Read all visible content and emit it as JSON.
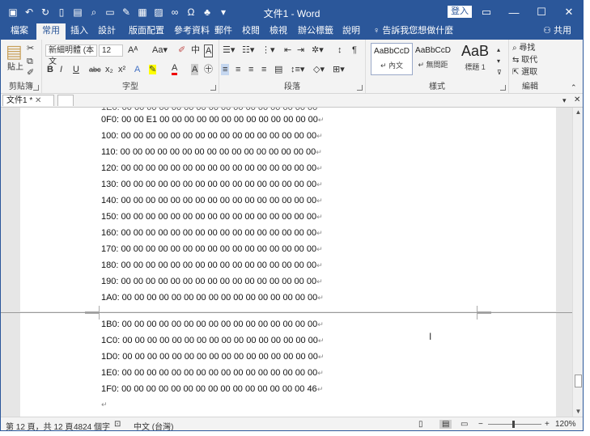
{
  "window": {
    "title": "文件1 - Word",
    "signin_label": "登入",
    "controls": [
      "▭",
      "—",
      "☐",
      "✕"
    ]
  },
  "qat": {
    "icons": [
      "save-icon",
      "undo-icon",
      "redo-icon",
      "new-icon",
      "open-icon",
      "print-preview-icon",
      "folder-icon",
      "format-painter-icon",
      "table-icon",
      "picture-icon",
      "link-icon",
      "omega-icon",
      "org-chart-icon",
      "dropdown-icon"
    ]
  },
  "ribbon_tabs": {
    "items": [
      "檔案",
      "常用",
      "插入",
      "設計",
      "版面配置",
      "參考資料",
      "郵件",
      "校閱",
      "檢視",
      "辦公標籤",
      "說明"
    ],
    "active": "常用",
    "tell_me": "告訴我您想做什麼",
    "share": "共用"
  },
  "clipboard": {
    "paste": "貼上",
    "label": "剪貼簿"
  },
  "font": {
    "name": "新細明體 (本文",
    "size": "12",
    "label": "字型",
    "buttons": [
      "B",
      "I",
      "U",
      "abc",
      "x₂",
      "x²",
      "A",
      "A"
    ]
  },
  "paragraph": {
    "label": "段落"
  },
  "styles": {
    "label": "樣式",
    "items": [
      {
        "sample": "AaBbCcD",
        "name": "↵ 內文"
      },
      {
        "sample": "AaBbCcD",
        "name": "↵ 無間距"
      },
      {
        "sample": "AaB",
        "name": "標題 1"
      }
    ]
  },
  "editing": {
    "label": "編輯",
    "find": "尋找",
    "replace": "取代",
    "select": "選取"
  },
  "doc_tabs": {
    "active": "文件1 *"
  },
  "document": {
    "lines_page1": [
      "0F0: 00 00 E1 00 00 00 00 00 00 00 00 00 00 00 00 00",
      "100: 00 00 00 00 00 00 00 00 00 00 00 00 00 00 00 00",
      "110: 00 00 00 00 00 00 00 00 00 00 00 00 00 00 00 00",
      "120: 00 00 00 00 00 00 00 00 00 00 00 00 00 00 00 00",
      "130: 00 00 00 00 00 00 00 00 00 00 00 00 00 00 00 00",
      "140: 00 00 00 00 00 00 00 00 00 00 00 00 00 00 00 00",
      "150: 00 00 00 00 00 00 00 00 00 00 00 00 00 00 00 00",
      "160: 00 00 00 00 00 00 00 00 00 00 00 00 00 00 00 00",
      "170: 00 00 00 00 00 00 00 00 00 00 00 00 00 00 00 00",
      "180: 00 00 00 00 00 00 00 00 00 00 00 00 00 00 00 00",
      "190: 00 00 00 00 00 00 00 00 00 00 00 00 00 00 00 00",
      "1A0: 00 00 00 00 00 00 00 00 00 00 00 00 00 00 00 00"
    ],
    "lines_page2": [
      "1B0: 00 00 00 00 00 00 00 00 00 00 00 00 00 00 00 00",
      "1C0: 00 00 00 00 00 00 00 00 00 00 00 00 00 00 00 00",
      "1D0: 00 00 00 00 00 00 00 00 00 00 00 00 00 00 00 00",
      "1E0: 00 00 00 00 00 00 00 00 00 00 00 00 00 00 00 00",
      "1F0: 00 00 00 00 00 00 00 00 00 00 00 00 00 00 00 46"
    ],
    "paragraph_mark": "↵"
  },
  "status": {
    "page": "第 12 頁，共 12 頁",
    "words": "4824 個字",
    "language": "中文 (台灣)",
    "zoom": "120%"
  },
  "colors": {
    "accent": "#2b579a",
    "ribbon_bg": "#f3f3f3",
    "doc_bg": "#e6e6e6"
  }
}
